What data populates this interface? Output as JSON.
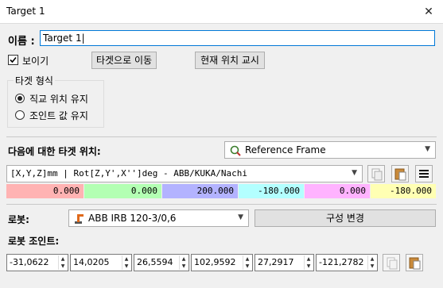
{
  "window": {
    "title": "Target 1",
    "close_glyph": "✕"
  },
  "name": {
    "label": "이름 :",
    "value": "Target 1|"
  },
  "visible": {
    "label": "보이기",
    "checked": true
  },
  "buttons": {
    "move_to": "타겟으로 이동",
    "teach_current": "현재 위치 교시",
    "config_change": "구성 변경"
  },
  "target_type": {
    "group_label": "타겟 형식",
    "options": [
      {
        "label": "직교 위치 유지",
        "selected": true
      },
      {
        "label": "조인트 값 유지",
        "selected": false
      }
    ]
  },
  "target_position": {
    "label": "다음에 대한 타겟 위치:",
    "reference": "Reference Frame",
    "format": "[X,Y,Z]mm | Rot[Z,Y',X'']deg - ABB/KUKA/Nachi",
    "values": [
      "0.000",
      "0.000",
      "200.000",
      "-180.000",
      "0.000",
      "-180.000"
    ],
    "colors": [
      "#ffb3b3",
      "#b3ffb3",
      "#b3b3ff",
      "#b3ffff",
      "#ffb3ff",
      "#ffffb3"
    ]
  },
  "robot": {
    "label": "로봇:",
    "value": "ABB IRB 120-3/0,6"
  },
  "robot_joints": {
    "label": "로봇 조인트:",
    "values": [
      "-31,0622",
      "14,0205",
      "26,5594",
      "102,9592",
      "27,2917",
      "-121,2782"
    ]
  }
}
